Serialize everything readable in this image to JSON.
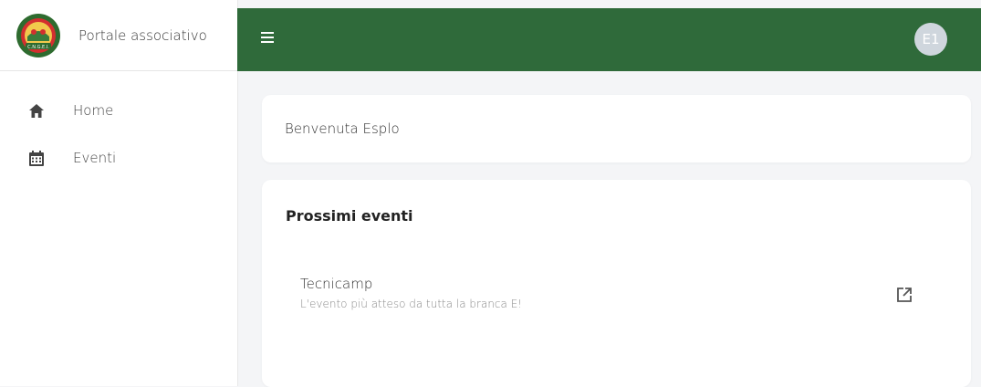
{
  "sidebar": {
    "brand_text": "Portale associativo",
    "logo_text": "C.N.G.E.I.",
    "items": [
      {
        "label": "Home",
        "icon": "home-icon"
      },
      {
        "label": "Eventi",
        "icon": "calendar-icon"
      }
    ]
  },
  "topbar": {
    "menu_icon": "hamburger-icon",
    "avatar_initials": "E1"
  },
  "welcome": {
    "text": "Benvenuta Esplo"
  },
  "events": {
    "title": "Prossimi eventi",
    "items": [
      {
        "name": "Tecnicamp",
        "description": "L'evento più atteso da tutta la branca E!",
        "action_icon": "open-in-new-icon"
      }
    ]
  },
  "colors": {
    "header_green": "#2f6a3a",
    "background": "#f4f5f7",
    "card": "#ffffff",
    "avatar_bg": "#cfd6dd"
  }
}
